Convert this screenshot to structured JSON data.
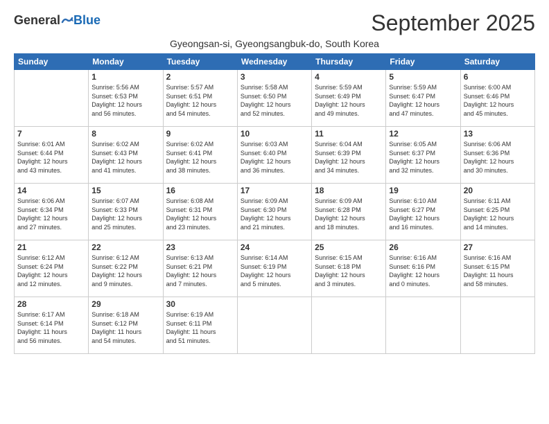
{
  "logo": {
    "general": "General",
    "blue": "Blue"
  },
  "title": "September 2025",
  "subtitle": "Gyeongsan-si, Gyeongsangbuk-do, South Korea",
  "headers": [
    "Sunday",
    "Monday",
    "Tuesday",
    "Wednesday",
    "Thursday",
    "Friday",
    "Saturday"
  ],
  "weeks": [
    [
      {
        "day": "",
        "info": ""
      },
      {
        "day": "1",
        "info": "Sunrise: 5:56 AM\nSunset: 6:53 PM\nDaylight: 12 hours\nand 56 minutes."
      },
      {
        "day": "2",
        "info": "Sunrise: 5:57 AM\nSunset: 6:51 PM\nDaylight: 12 hours\nand 54 minutes."
      },
      {
        "day": "3",
        "info": "Sunrise: 5:58 AM\nSunset: 6:50 PM\nDaylight: 12 hours\nand 52 minutes."
      },
      {
        "day": "4",
        "info": "Sunrise: 5:59 AM\nSunset: 6:49 PM\nDaylight: 12 hours\nand 49 minutes."
      },
      {
        "day": "5",
        "info": "Sunrise: 5:59 AM\nSunset: 6:47 PM\nDaylight: 12 hours\nand 47 minutes."
      },
      {
        "day": "6",
        "info": "Sunrise: 6:00 AM\nSunset: 6:46 PM\nDaylight: 12 hours\nand 45 minutes."
      }
    ],
    [
      {
        "day": "7",
        "info": "Sunrise: 6:01 AM\nSunset: 6:44 PM\nDaylight: 12 hours\nand 43 minutes."
      },
      {
        "day": "8",
        "info": "Sunrise: 6:02 AM\nSunset: 6:43 PM\nDaylight: 12 hours\nand 41 minutes."
      },
      {
        "day": "9",
        "info": "Sunrise: 6:02 AM\nSunset: 6:41 PM\nDaylight: 12 hours\nand 38 minutes."
      },
      {
        "day": "10",
        "info": "Sunrise: 6:03 AM\nSunset: 6:40 PM\nDaylight: 12 hours\nand 36 minutes."
      },
      {
        "day": "11",
        "info": "Sunrise: 6:04 AM\nSunset: 6:39 PM\nDaylight: 12 hours\nand 34 minutes."
      },
      {
        "day": "12",
        "info": "Sunrise: 6:05 AM\nSunset: 6:37 PM\nDaylight: 12 hours\nand 32 minutes."
      },
      {
        "day": "13",
        "info": "Sunrise: 6:06 AM\nSunset: 6:36 PM\nDaylight: 12 hours\nand 30 minutes."
      }
    ],
    [
      {
        "day": "14",
        "info": "Sunrise: 6:06 AM\nSunset: 6:34 PM\nDaylight: 12 hours\nand 27 minutes."
      },
      {
        "day": "15",
        "info": "Sunrise: 6:07 AM\nSunset: 6:33 PM\nDaylight: 12 hours\nand 25 minutes."
      },
      {
        "day": "16",
        "info": "Sunrise: 6:08 AM\nSunset: 6:31 PM\nDaylight: 12 hours\nand 23 minutes."
      },
      {
        "day": "17",
        "info": "Sunrise: 6:09 AM\nSunset: 6:30 PM\nDaylight: 12 hours\nand 21 minutes."
      },
      {
        "day": "18",
        "info": "Sunrise: 6:09 AM\nSunset: 6:28 PM\nDaylight: 12 hours\nand 18 minutes."
      },
      {
        "day": "19",
        "info": "Sunrise: 6:10 AM\nSunset: 6:27 PM\nDaylight: 12 hours\nand 16 minutes."
      },
      {
        "day": "20",
        "info": "Sunrise: 6:11 AM\nSunset: 6:25 PM\nDaylight: 12 hours\nand 14 minutes."
      }
    ],
    [
      {
        "day": "21",
        "info": "Sunrise: 6:12 AM\nSunset: 6:24 PM\nDaylight: 12 hours\nand 12 minutes."
      },
      {
        "day": "22",
        "info": "Sunrise: 6:12 AM\nSunset: 6:22 PM\nDaylight: 12 hours\nand 9 minutes."
      },
      {
        "day": "23",
        "info": "Sunrise: 6:13 AM\nSunset: 6:21 PM\nDaylight: 12 hours\nand 7 minutes."
      },
      {
        "day": "24",
        "info": "Sunrise: 6:14 AM\nSunset: 6:19 PM\nDaylight: 12 hours\nand 5 minutes."
      },
      {
        "day": "25",
        "info": "Sunrise: 6:15 AM\nSunset: 6:18 PM\nDaylight: 12 hours\nand 3 minutes."
      },
      {
        "day": "26",
        "info": "Sunrise: 6:16 AM\nSunset: 6:16 PM\nDaylight: 12 hours\nand 0 minutes."
      },
      {
        "day": "27",
        "info": "Sunrise: 6:16 AM\nSunset: 6:15 PM\nDaylight: 11 hours\nand 58 minutes."
      }
    ],
    [
      {
        "day": "28",
        "info": "Sunrise: 6:17 AM\nSunset: 6:14 PM\nDaylight: 11 hours\nand 56 minutes."
      },
      {
        "day": "29",
        "info": "Sunrise: 6:18 AM\nSunset: 6:12 PM\nDaylight: 11 hours\nand 54 minutes."
      },
      {
        "day": "30",
        "info": "Sunrise: 6:19 AM\nSunset: 6:11 PM\nDaylight: 11 hours\nand 51 minutes."
      },
      {
        "day": "",
        "info": ""
      },
      {
        "day": "",
        "info": ""
      },
      {
        "day": "",
        "info": ""
      },
      {
        "day": "",
        "info": ""
      }
    ]
  ]
}
